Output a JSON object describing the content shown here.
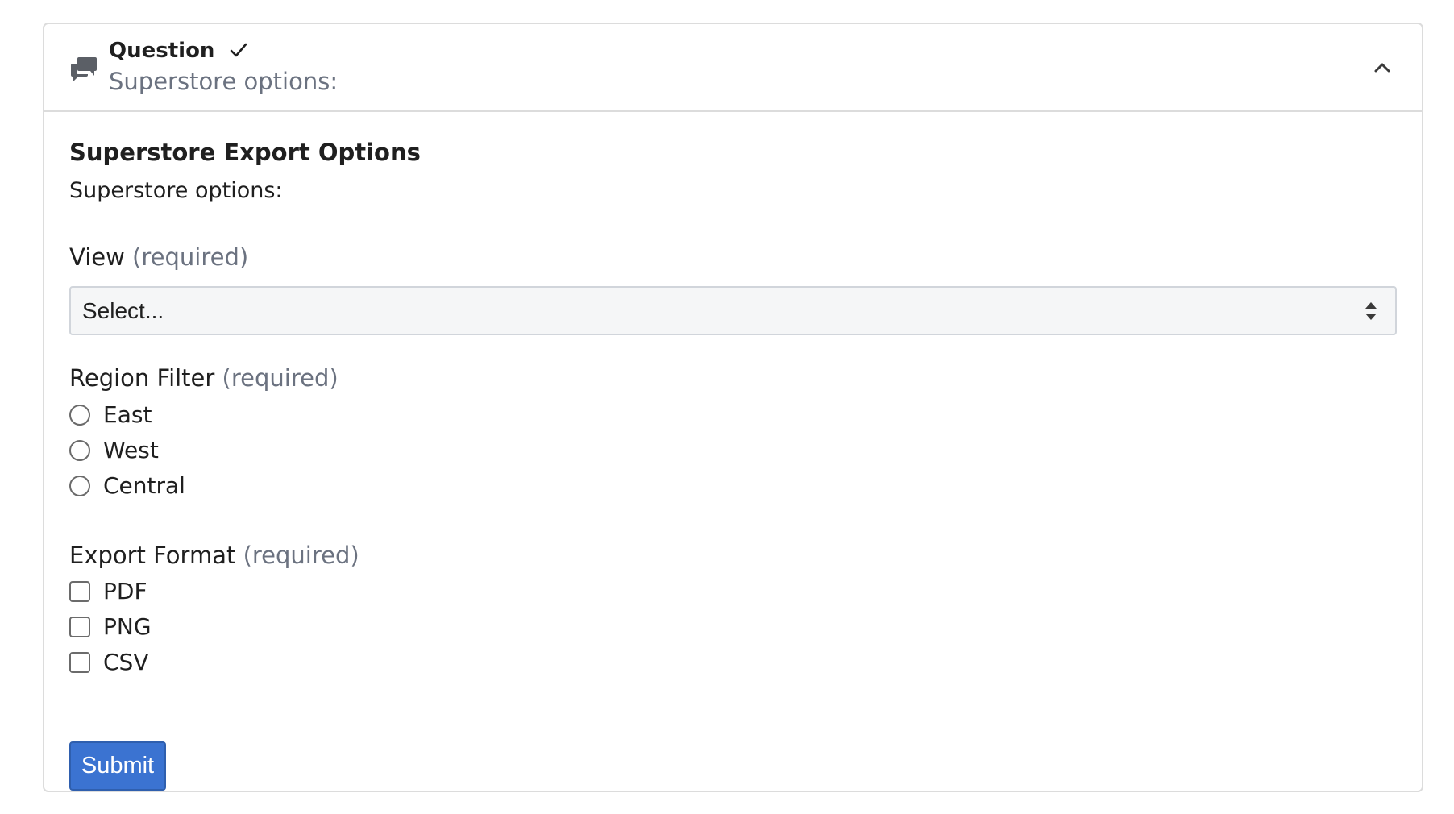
{
  "question": {
    "title": "Question",
    "status_icon": "check-icon",
    "subtitle": "Superstore options:",
    "icon": "chat-bubbles-icon",
    "collapse_icon": "chevron-up-icon"
  },
  "form": {
    "title": "Superstore Export Options",
    "description": "Superstore options:",
    "view": {
      "label": "View",
      "required": "(required)",
      "selected": "Select..."
    },
    "region": {
      "label": "Region Filter",
      "required": "(required)",
      "options": [
        "East",
        "West",
        "Central"
      ]
    },
    "format": {
      "label": "Export Format",
      "required": "(required)",
      "options": [
        "PDF",
        "PNG",
        "CSV"
      ]
    },
    "submit_label": "Submit"
  },
  "colors": {
    "accent": "#3b73d1",
    "muted_text": "#6b7280",
    "border": "#dcdcdc"
  }
}
